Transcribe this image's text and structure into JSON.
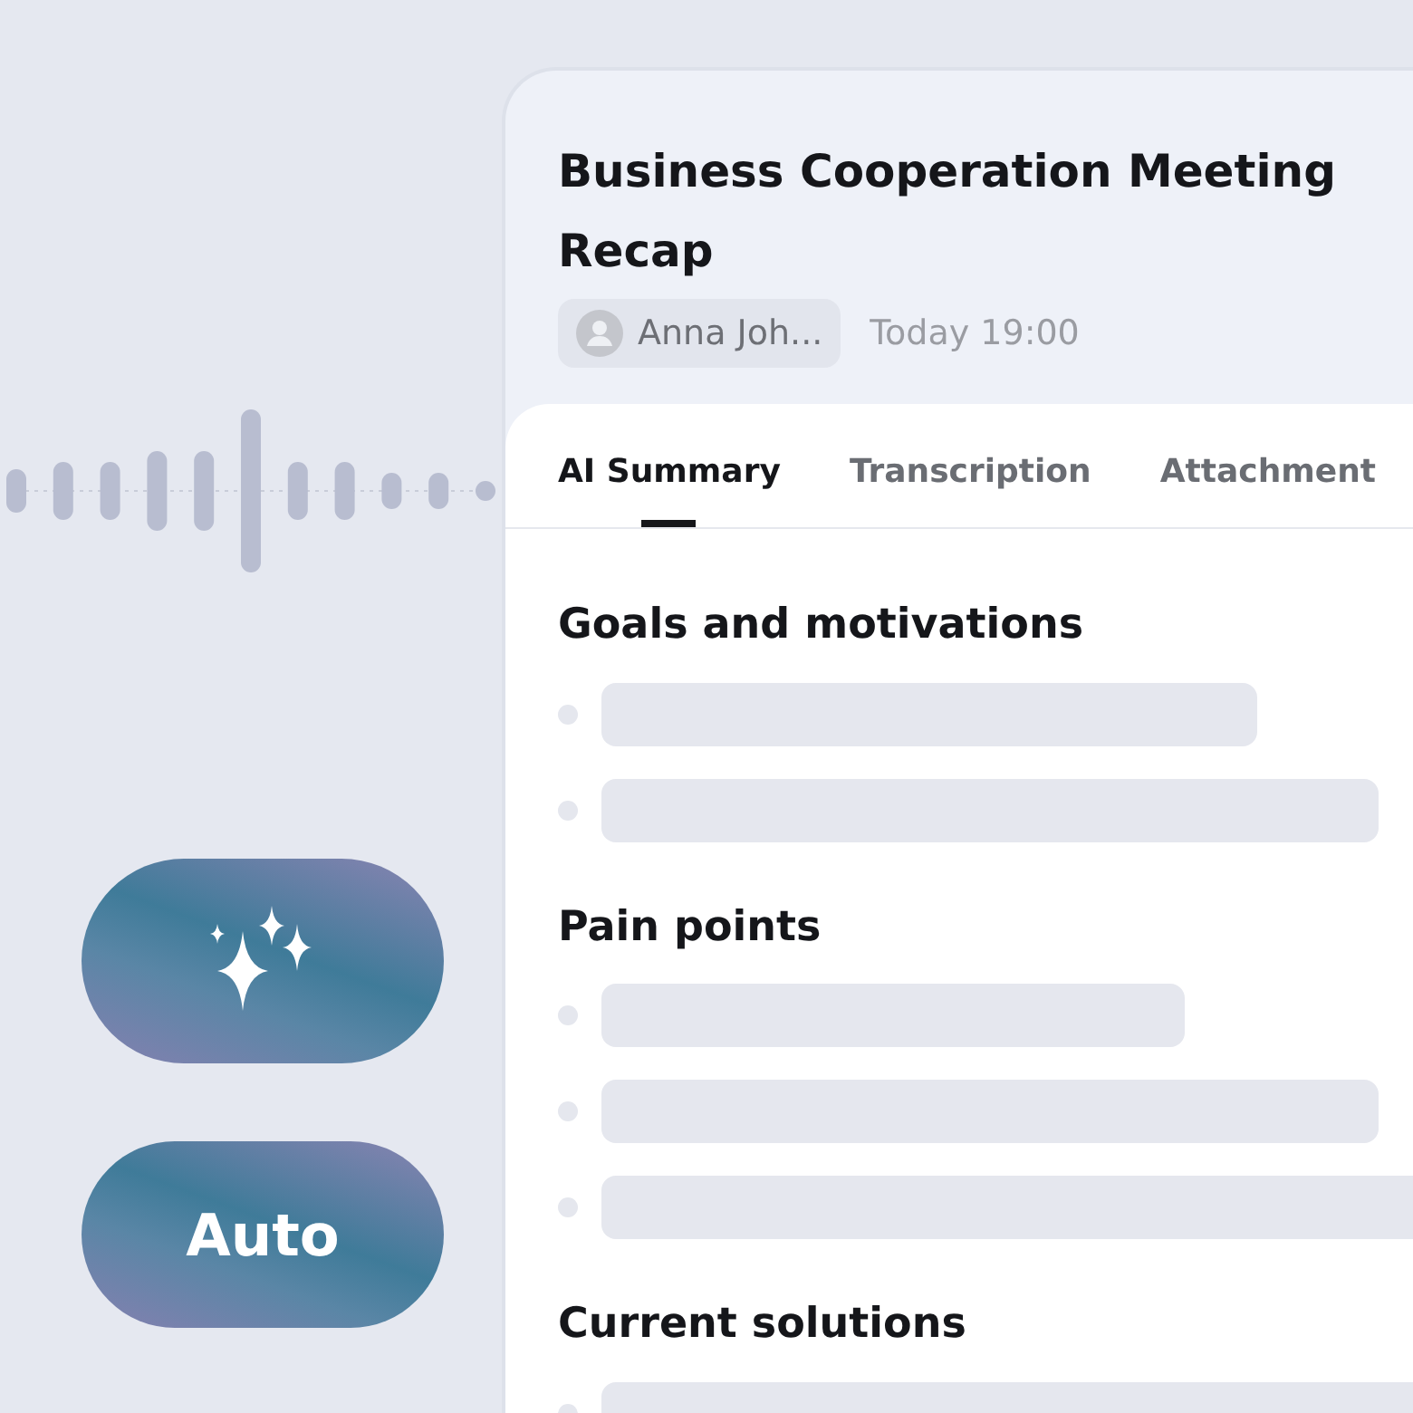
{
  "modes": [
    {
      "kind": "sparkle"
    },
    {
      "kind": "text",
      "label": "Auto"
    }
  ],
  "note": {
    "title": "Business Cooperation Meeting Recap",
    "author": "Anna Joh...",
    "time": "Today 19:00"
  },
  "tabs": [
    {
      "label": "AI Summary",
      "selected": true
    },
    {
      "label": "Transcription",
      "selected": false
    },
    {
      "label": "Attachment",
      "selected": false
    }
  ],
  "sections": [
    {
      "heading": "Goals and motivations",
      "lines": [
        {
          "kind": "medium"
        },
        {
          "kind": "long"
        }
      ]
    },
    {
      "heading": "Pain points",
      "lines": [
        {
          "kind": "short"
        },
        {
          "kind": "long"
        },
        {
          "kind": "full"
        }
      ]
    },
    {
      "heading": "Current solutions",
      "lines": [
        {
          "kind": "full"
        }
      ]
    }
  ]
}
